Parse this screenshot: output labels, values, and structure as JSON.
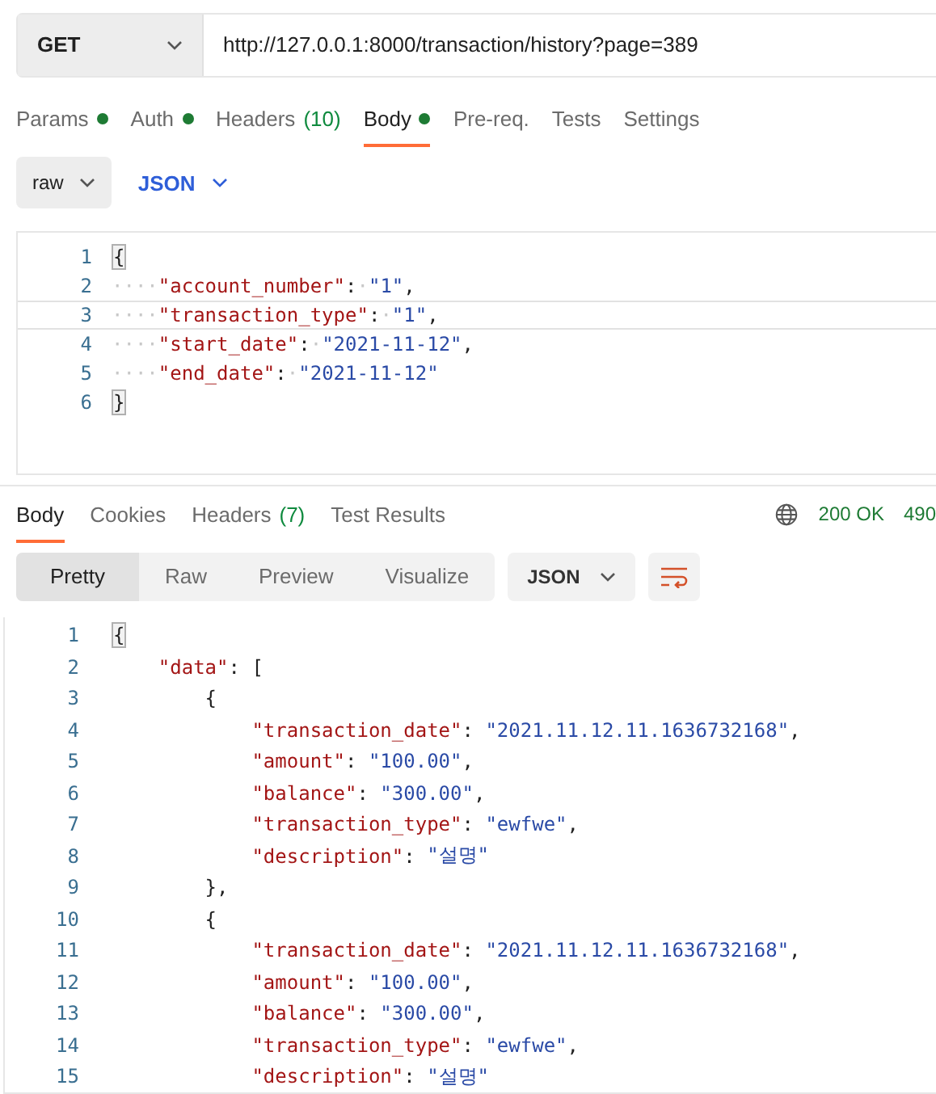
{
  "request": {
    "method": "GET",
    "url": "http://127.0.0.1:8000/transaction/history?page=389"
  },
  "request_tabs": [
    {
      "label": "Params",
      "dot": true,
      "selected": false
    },
    {
      "label": "Auth",
      "dot": true,
      "selected": false
    },
    {
      "label": "Headers",
      "count": "(10)",
      "dot": false,
      "selected": false
    },
    {
      "label": "Body",
      "dot": true,
      "selected": true
    },
    {
      "label": "Pre-req.",
      "dot": false,
      "selected": false
    },
    {
      "label": "Tests",
      "dot": false,
      "selected": false
    },
    {
      "label": "Settings",
      "dot": false,
      "selected": false
    }
  ],
  "body_options": {
    "mode": "raw",
    "format": "JSON"
  },
  "request_body": [
    {
      "number": "1",
      "active": false,
      "tokens": [
        {
          "kind": "bracket",
          "text": "{"
        }
      ]
    },
    {
      "number": "2",
      "active": false,
      "tokens": [
        {
          "kind": "ws",
          "text": "····"
        },
        {
          "kind": "key",
          "text": "\"account_number\""
        },
        {
          "kind": "punct",
          "text": ":"
        },
        {
          "kind": "ws",
          "text": "·"
        },
        {
          "kind": "str",
          "text": "\"1\""
        },
        {
          "kind": "punct",
          "text": ","
        }
      ]
    },
    {
      "number": "3",
      "active": true,
      "tokens": [
        {
          "kind": "ws",
          "text": "····"
        },
        {
          "kind": "key",
          "text": "\"transaction_type\""
        },
        {
          "kind": "punct",
          "text": ":"
        },
        {
          "kind": "ws",
          "text": "·"
        },
        {
          "kind": "str",
          "text": "\"1\""
        },
        {
          "kind": "punct",
          "text": ","
        }
      ]
    },
    {
      "number": "4",
      "active": false,
      "tokens": [
        {
          "kind": "ws",
          "text": "····"
        },
        {
          "kind": "key",
          "text": "\"start_date\""
        },
        {
          "kind": "punct",
          "text": ":"
        },
        {
          "kind": "ws",
          "text": "·"
        },
        {
          "kind": "str",
          "text": "\"2021-11-12\""
        },
        {
          "kind": "punct",
          "text": ","
        }
      ]
    },
    {
      "number": "5",
      "active": false,
      "tokens": [
        {
          "kind": "ws",
          "text": "····"
        },
        {
          "kind": "key",
          "text": "\"end_date\""
        },
        {
          "kind": "punct",
          "text": ":"
        },
        {
          "kind": "ws",
          "text": "·"
        },
        {
          "kind": "str",
          "text": "\"2021-11-12\""
        }
      ]
    },
    {
      "number": "6",
      "active": false,
      "tokens": [
        {
          "kind": "bracket",
          "text": "}"
        }
      ]
    }
  ],
  "response_tabs": [
    {
      "label": "Body",
      "selected": true
    },
    {
      "label": "Cookies",
      "selected": false
    },
    {
      "label": "Headers",
      "count": "(7)",
      "selected": false
    },
    {
      "label": "Test Results",
      "selected": false
    }
  ],
  "response_status": {
    "status": "200 OK",
    "time": "490"
  },
  "view_modes": [
    {
      "label": "Pretty",
      "selected": true
    },
    {
      "label": "Raw",
      "selected": false
    },
    {
      "label": "Preview",
      "selected": false
    },
    {
      "label": "Visualize",
      "selected": false
    }
  ],
  "response_format": "JSON",
  "response_body": [
    {
      "number": "1",
      "tokens": [
        {
          "kind": "bracket",
          "text": "{"
        }
      ]
    },
    {
      "number": "2",
      "tokens": [
        {
          "kind": "key",
          "text": "    \"data\""
        },
        {
          "kind": "punct",
          "text": ": ["
        }
      ]
    },
    {
      "number": "3",
      "tokens": [
        {
          "kind": "punct",
          "text": "        {"
        }
      ]
    },
    {
      "number": "4",
      "tokens": [
        {
          "kind": "key",
          "text": "            \"transaction_date\""
        },
        {
          "kind": "punct",
          "text": ": "
        },
        {
          "kind": "str",
          "text": "\"2021.11.12.11.1636732168\""
        },
        {
          "kind": "punct",
          "text": ","
        }
      ]
    },
    {
      "number": "5",
      "tokens": [
        {
          "kind": "key",
          "text": "            \"amount\""
        },
        {
          "kind": "punct",
          "text": ": "
        },
        {
          "kind": "str",
          "text": "\"100.00\""
        },
        {
          "kind": "punct",
          "text": ","
        }
      ]
    },
    {
      "number": "6",
      "tokens": [
        {
          "kind": "key",
          "text": "            \"balance\""
        },
        {
          "kind": "punct",
          "text": ": "
        },
        {
          "kind": "str",
          "text": "\"300.00\""
        },
        {
          "kind": "punct",
          "text": ","
        }
      ]
    },
    {
      "number": "7",
      "tokens": [
        {
          "kind": "key",
          "text": "            \"transaction_type\""
        },
        {
          "kind": "punct",
          "text": ": "
        },
        {
          "kind": "str",
          "text": "\"ewfwe\""
        },
        {
          "kind": "punct",
          "text": ","
        }
      ]
    },
    {
      "number": "8",
      "tokens": [
        {
          "kind": "key",
          "text": "            \"description\""
        },
        {
          "kind": "punct",
          "text": ": "
        },
        {
          "kind": "str",
          "text": "\"설명\""
        }
      ]
    },
    {
      "number": "9",
      "tokens": [
        {
          "kind": "punct",
          "text": "        },"
        }
      ]
    },
    {
      "number": "10",
      "tokens": [
        {
          "kind": "punct",
          "text": "        {"
        }
      ]
    },
    {
      "number": "11",
      "tokens": [
        {
          "kind": "key",
          "text": "            \"transaction_date\""
        },
        {
          "kind": "punct",
          "text": ": "
        },
        {
          "kind": "str",
          "text": "\"2021.11.12.11.1636732168\""
        },
        {
          "kind": "punct",
          "text": ","
        }
      ]
    },
    {
      "number": "12",
      "tokens": [
        {
          "kind": "key",
          "text": "            \"amount\""
        },
        {
          "kind": "punct",
          "text": ": "
        },
        {
          "kind": "str",
          "text": "\"100.00\""
        },
        {
          "kind": "punct",
          "text": ","
        }
      ]
    },
    {
      "number": "13",
      "tokens": [
        {
          "kind": "key",
          "text": "            \"balance\""
        },
        {
          "kind": "punct",
          "text": ": "
        },
        {
          "kind": "str",
          "text": "\"300.00\""
        },
        {
          "kind": "punct",
          "text": ","
        }
      ]
    },
    {
      "number": "14",
      "tokens": [
        {
          "kind": "key",
          "text": "            \"transaction_type\""
        },
        {
          "kind": "punct",
          "text": ": "
        },
        {
          "kind": "str",
          "text": "\"ewfwe\""
        },
        {
          "kind": "punct",
          "text": ","
        }
      ]
    },
    {
      "number": "15",
      "tokens": [
        {
          "kind": "key",
          "text": "            \"description\""
        },
        {
          "kind": "punct",
          "text": ": "
        },
        {
          "kind": "str",
          "text": "\"설명\""
        }
      ]
    }
  ]
}
